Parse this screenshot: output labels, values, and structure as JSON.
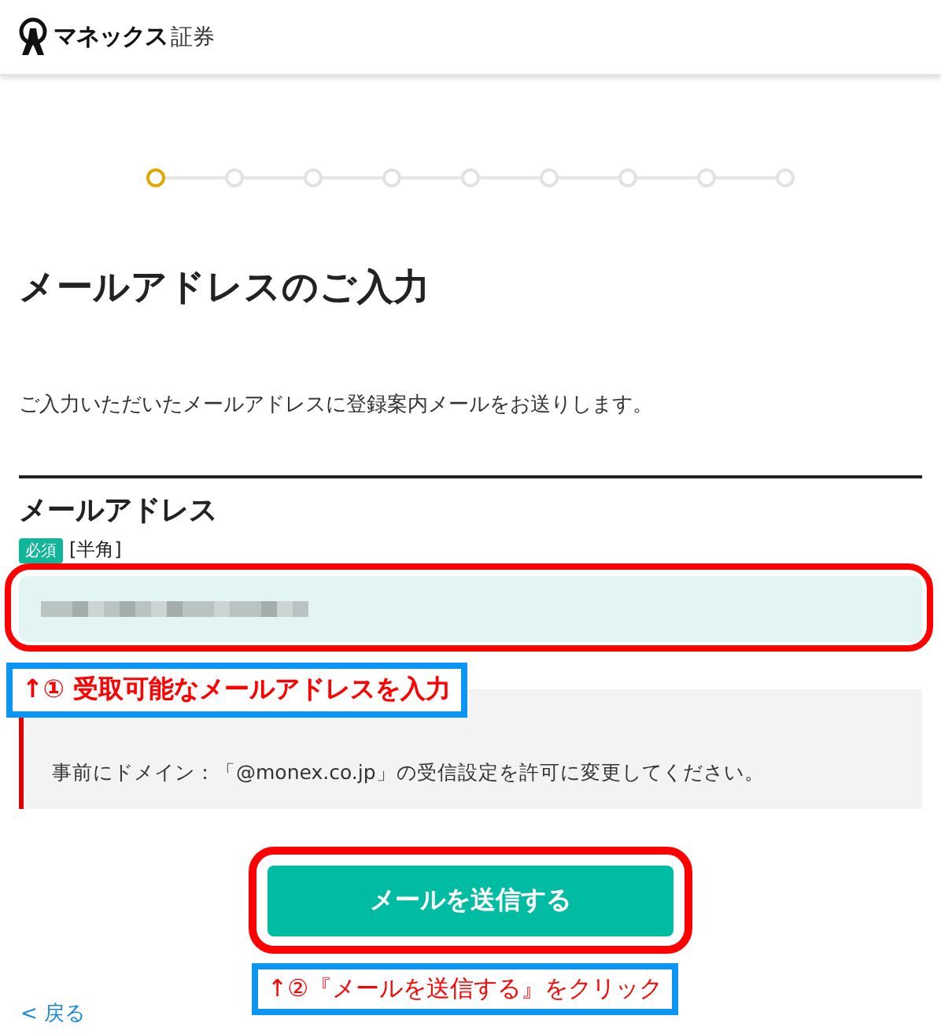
{
  "header": {
    "logo_text": "マネックス",
    "logo_suffix": "証券"
  },
  "stepper": [
    {
      "selected": true
    },
    {
      "selected": false
    },
    {
      "selected": false
    },
    {
      "selected": false
    },
    {
      "selected": false
    },
    {
      "selected": false
    },
    {
      "selected": false
    },
    {
      "selected": false
    },
    {
      "selected": false
    }
  ],
  "title": "メールアドレスのご入力",
  "description": "ご入力いただいたメールアドレスに登録案内メールをお送りします。",
  "field": {
    "label": "メールアドレス",
    "badge": "必須",
    "hint": "[半角]",
    "masked": true
  },
  "callout_1": "↑① 受取可能なメールアドレスを入力",
  "note": "事前にドメイン：「@monex.co.jp」の受信設定を許可に変更してください。",
  "submit_button": "メールを送信する",
  "callout_2": "↑②『メールを送信する』をクリック",
  "back_link": "< 戻る"
}
